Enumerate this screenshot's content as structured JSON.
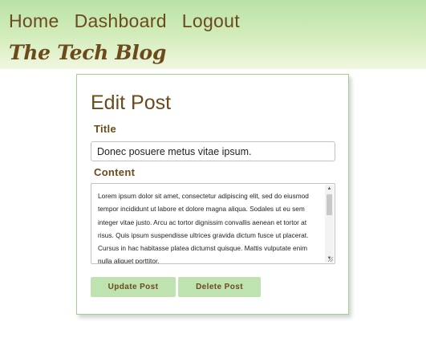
{
  "nav": {
    "items": [
      "Home",
      "Dashboard",
      "Logout"
    ]
  },
  "brand": "The Tech Blog",
  "card": {
    "heading": "Edit Post",
    "title_label": "Title",
    "title_value": "Donec posuere metus vitae ipsum.",
    "content_label": "Content",
    "content_value": "Lorem ipsum dolor sit amet, consectetur adipiscing elit, sed do eiusmod tempor incididunt ut labore et dolore magna aliqua. Sodales ut eu sem integer vitae justo. Arcu ac tortor dignissim convallis aenean et tortor at risus. Quis ipsum suspendisse ultrices gravida dictum fusce ut placerat. Cursus in hac habitasse platea dictumst quisque. Mattis vulputate enim nulla aliquet porttitor.",
    "update_label": "Update Post",
    "delete_label": "Delete Post"
  },
  "icons": {
    "scroll_up": "scroll-up-arrow-icon",
    "scroll_down": "scroll-down-arrow-icon",
    "resize": "resize-grip-icon"
  },
  "colors": {
    "brand_brown": "#6b4a1c",
    "header_green_top": "#b9e2a6",
    "header_green_bottom": "#f1f7e0",
    "button_green": "#bfe2b1",
    "card_border": "#9fd08c"
  }
}
